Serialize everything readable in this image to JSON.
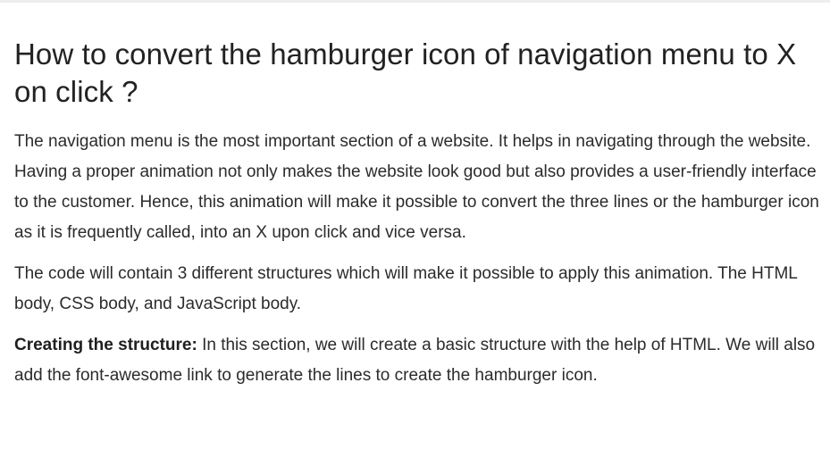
{
  "article": {
    "title": "How to convert the hamburger icon of navigation menu to X on click ?",
    "paragraph1": "The navigation menu is the most important section of a website. It helps in navigating through the website. Having a proper animation not only makes the website look good but also provides a user-friendly interface to the customer. Hence, this animation will make it possible to convert the three lines or the hamburger icon as it is frequently called, into an X upon click and vice versa.",
    "paragraph2": "The code will contain 3 different structures which will make it possible to apply this animation. The HTML body, CSS body, and JavaScript body.",
    "paragraph3_lead": "Creating the structure:",
    "paragraph3_text": " In this section, we will create a basic structure with the help of HTML. We will also add the font-awesome link to generate the lines to create the hamburger icon."
  }
}
